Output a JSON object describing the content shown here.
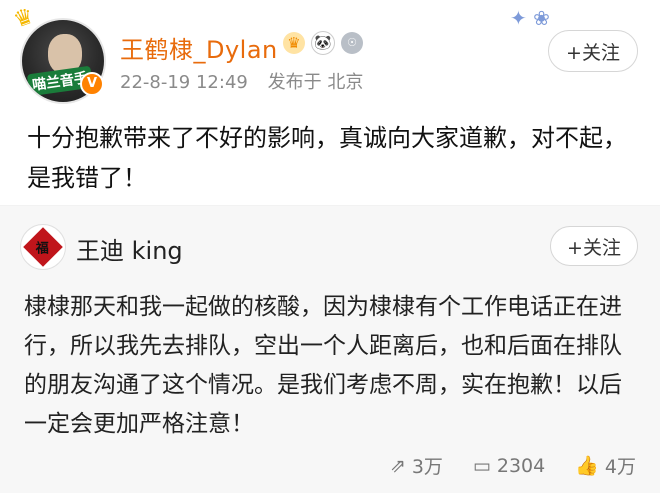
{
  "post": {
    "username": "王鹤棣_Dylan",
    "badges": [
      "crown-icon",
      "panda-icon",
      "medal-icon"
    ],
    "timestamp": "22-8-19 12:49",
    "source": "发布于 北京",
    "follow_label": "+关注",
    "content": "十分抱歉带来了不好的影响，真诚向大家道歉，对不起，是我错了！",
    "avatar_tag": "喵兰音手"
  },
  "quote": {
    "username": "王迪 king",
    "follow_label": "+关注",
    "content": "棣棣那天和我一起做的核酸，因为棣棣有个工作电话正在进行，所以我先去排队，空出一个人距离后，也和后面在排队的朋友沟通了这个情况。是我们考虑不周，实在抱歉！以后一定会更加严格注意！",
    "actions": {
      "repost_count": "3万",
      "comment_count": "2304",
      "like_count": "4万"
    }
  },
  "colors": {
    "username_orange": "#e86b0c",
    "verified_orange": "#ff8200",
    "quote_bg": "#f7f7f7"
  }
}
